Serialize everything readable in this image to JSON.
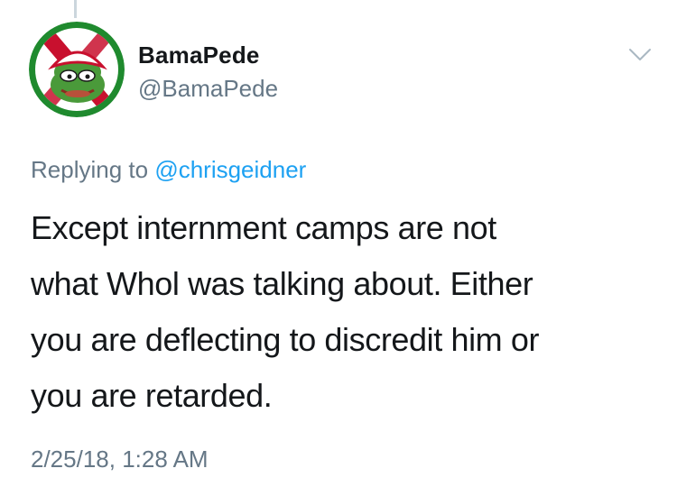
{
  "tweet": {
    "display_name": "BamaPede",
    "handle": "@BamaPede",
    "replying_prefix": "Replying to",
    "replying_to": "@chrisgeidner",
    "text_lines": [
      "Except internment camps are not",
      "what Whol was talking about. Either",
      "you are deflecting to discredit him or",
      "you are retarded."
    ],
    "timestamp": "2/25/18, 1:28 AM"
  },
  "icons": {
    "menu": "chevron-down-icon",
    "avatar": "pepe-frog-avatar"
  },
  "colors": {
    "text_primary": "#14171a",
    "text_secondary": "#657786",
    "link": "#1da1f2",
    "thread_line": "#ccd6dd",
    "avatar_ring": "#1f8a2e",
    "avatar_stripe": "#c8102e"
  }
}
